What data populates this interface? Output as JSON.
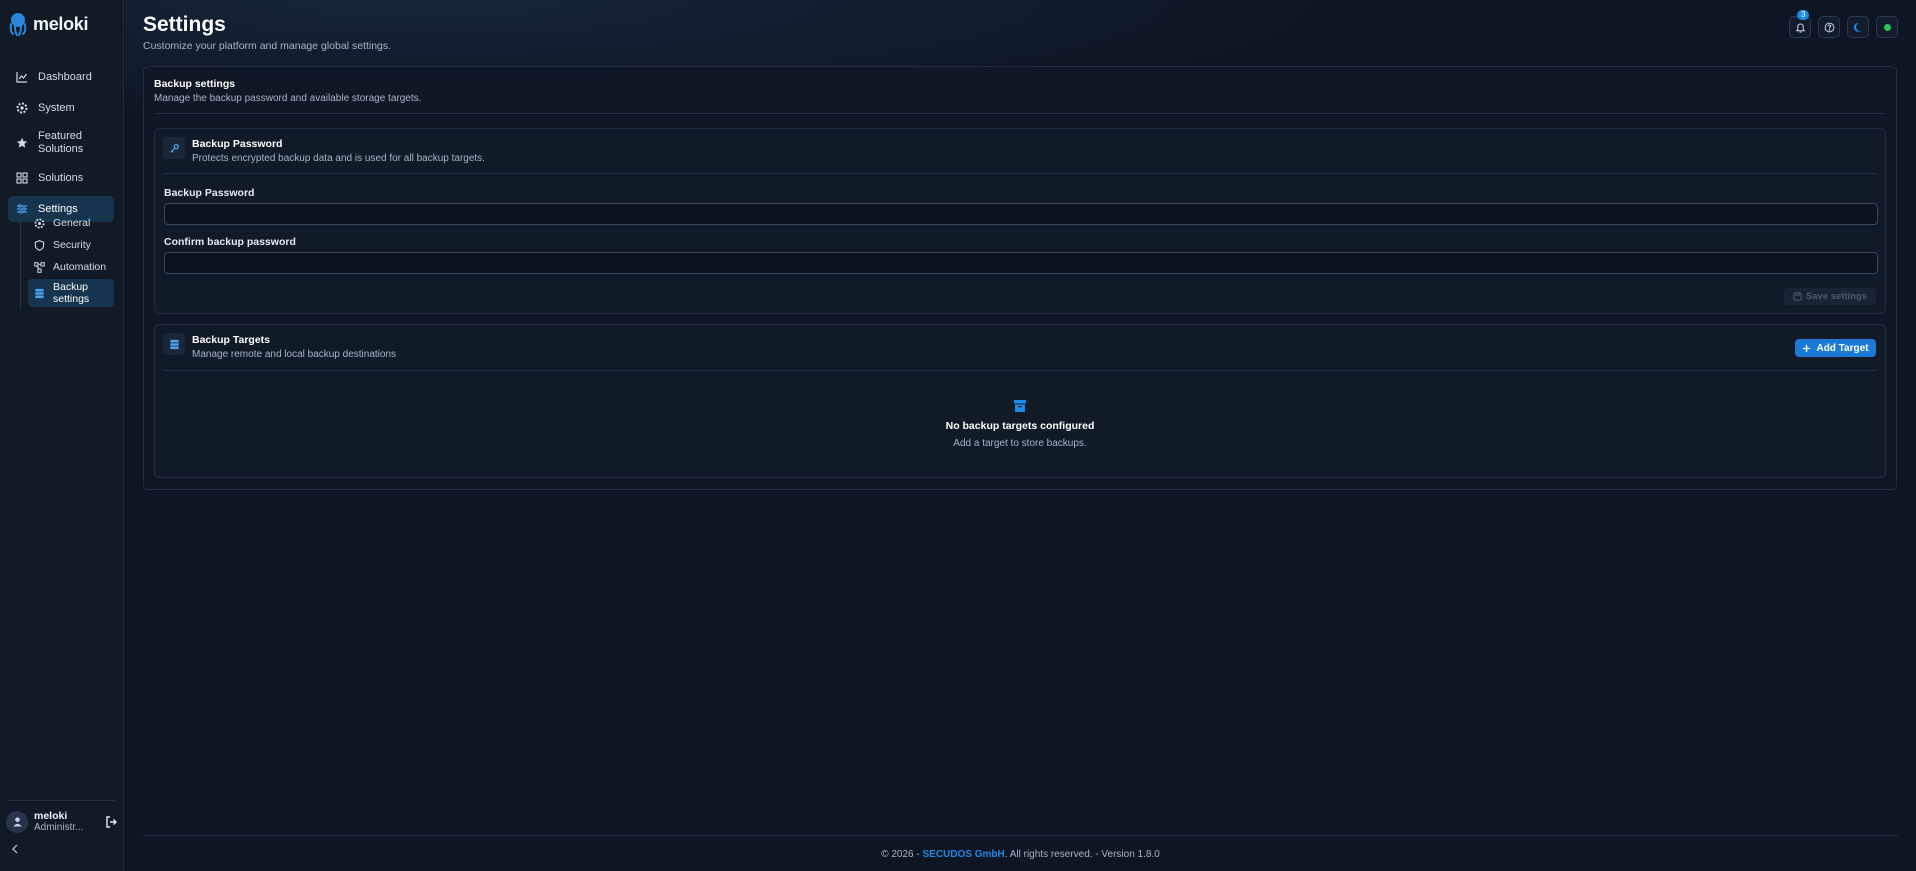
{
  "app": {
    "name": "meloki"
  },
  "sidebar": {
    "items": [
      {
        "label": "Dashboard",
        "icon": "chart-line-icon"
      },
      {
        "label": "System",
        "icon": "gear-icon"
      },
      {
        "label": "Featured Solutions",
        "icon": "star-icon"
      },
      {
        "label": "Solutions",
        "icon": "grid-icon"
      },
      {
        "label": "Settings",
        "icon": "sliders-icon",
        "active": true
      }
    ],
    "subitems": [
      {
        "label": "General",
        "icon": "gear-icon"
      },
      {
        "label": "Security",
        "icon": "shield-icon"
      },
      {
        "label": "Automation",
        "icon": "workflow-icon"
      },
      {
        "label": "Backup settings",
        "icon": "database-icon",
        "active": true
      }
    ],
    "user": {
      "name": "meloki",
      "role": "Administr..."
    }
  },
  "header": {
    "title": "Settings",
    "subtitle": "Customize your platform and manage global settings.",
    "notifications_count": "3"
  },
  "backup": {
    "title": "Backup settings",
    "subtitle": "Manage the backup password and available storage targets.",
    "password_panel": {
      "title": "Backup Password",
      "subtitle": "Protects encrypted backup data and is used for all backup targets.",
      "password_label": "Backup Password",
      "password_value": "",
      "confirm_label": "Confirm backup password",
      "confirm_value": "",
      "save_label": "Save settings"
    },
    "targets_panel": {
      "title": "Backup Targets",
      "subtitle": "Manage remote and local backup destinations",
      "add_label": "Add Target",
      "empty_title": "No backup targets configured",
      "empty_sub": "Add a target to store backups."
    }
  },
  "footer": {
    "prefix": "© 2026 - ",
    "brand": "SECUDOS GmbH",
    "suffix": ". All rights reserved. - Version 1.8.0"
  },
  "colors": {
    "accent": "#1d8ae6",
    "status_online": "#22c55e",
    "background": "#0f1623"
  }
}
